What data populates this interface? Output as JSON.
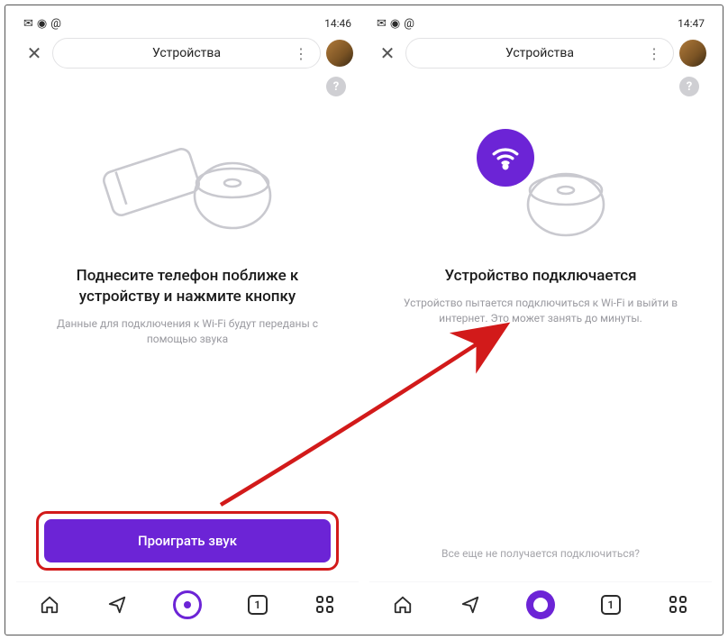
{
  "left": {
    "status": {
      "time": "14:46"
    },
    "header": {
      "title": "Устройства"
    },
    "heading": "Поднесите телефон поближе к устройству и нажмите кнопку",
    "subtext": "Данные для подключения к Wi-Fi будут переданы с помощью звука",
    "button": "Проиграть звук",
    "nav": {
      "tabs": "1"
    }
  },
  "right": {
    "status": {
      "time": "14:47"
    },
    "header": {
      "title": "Устройства"
    },
    "heading": "Устройство подключается",
    "subtext": "Устройство пытается подключиться к Wi-Fi и выйти в интернет. Это может занять до минуты.",
    "footer_link": "Все еще не получается подключиться?",
    "nav": {
      "tabs": "1"
    }
  }
}
